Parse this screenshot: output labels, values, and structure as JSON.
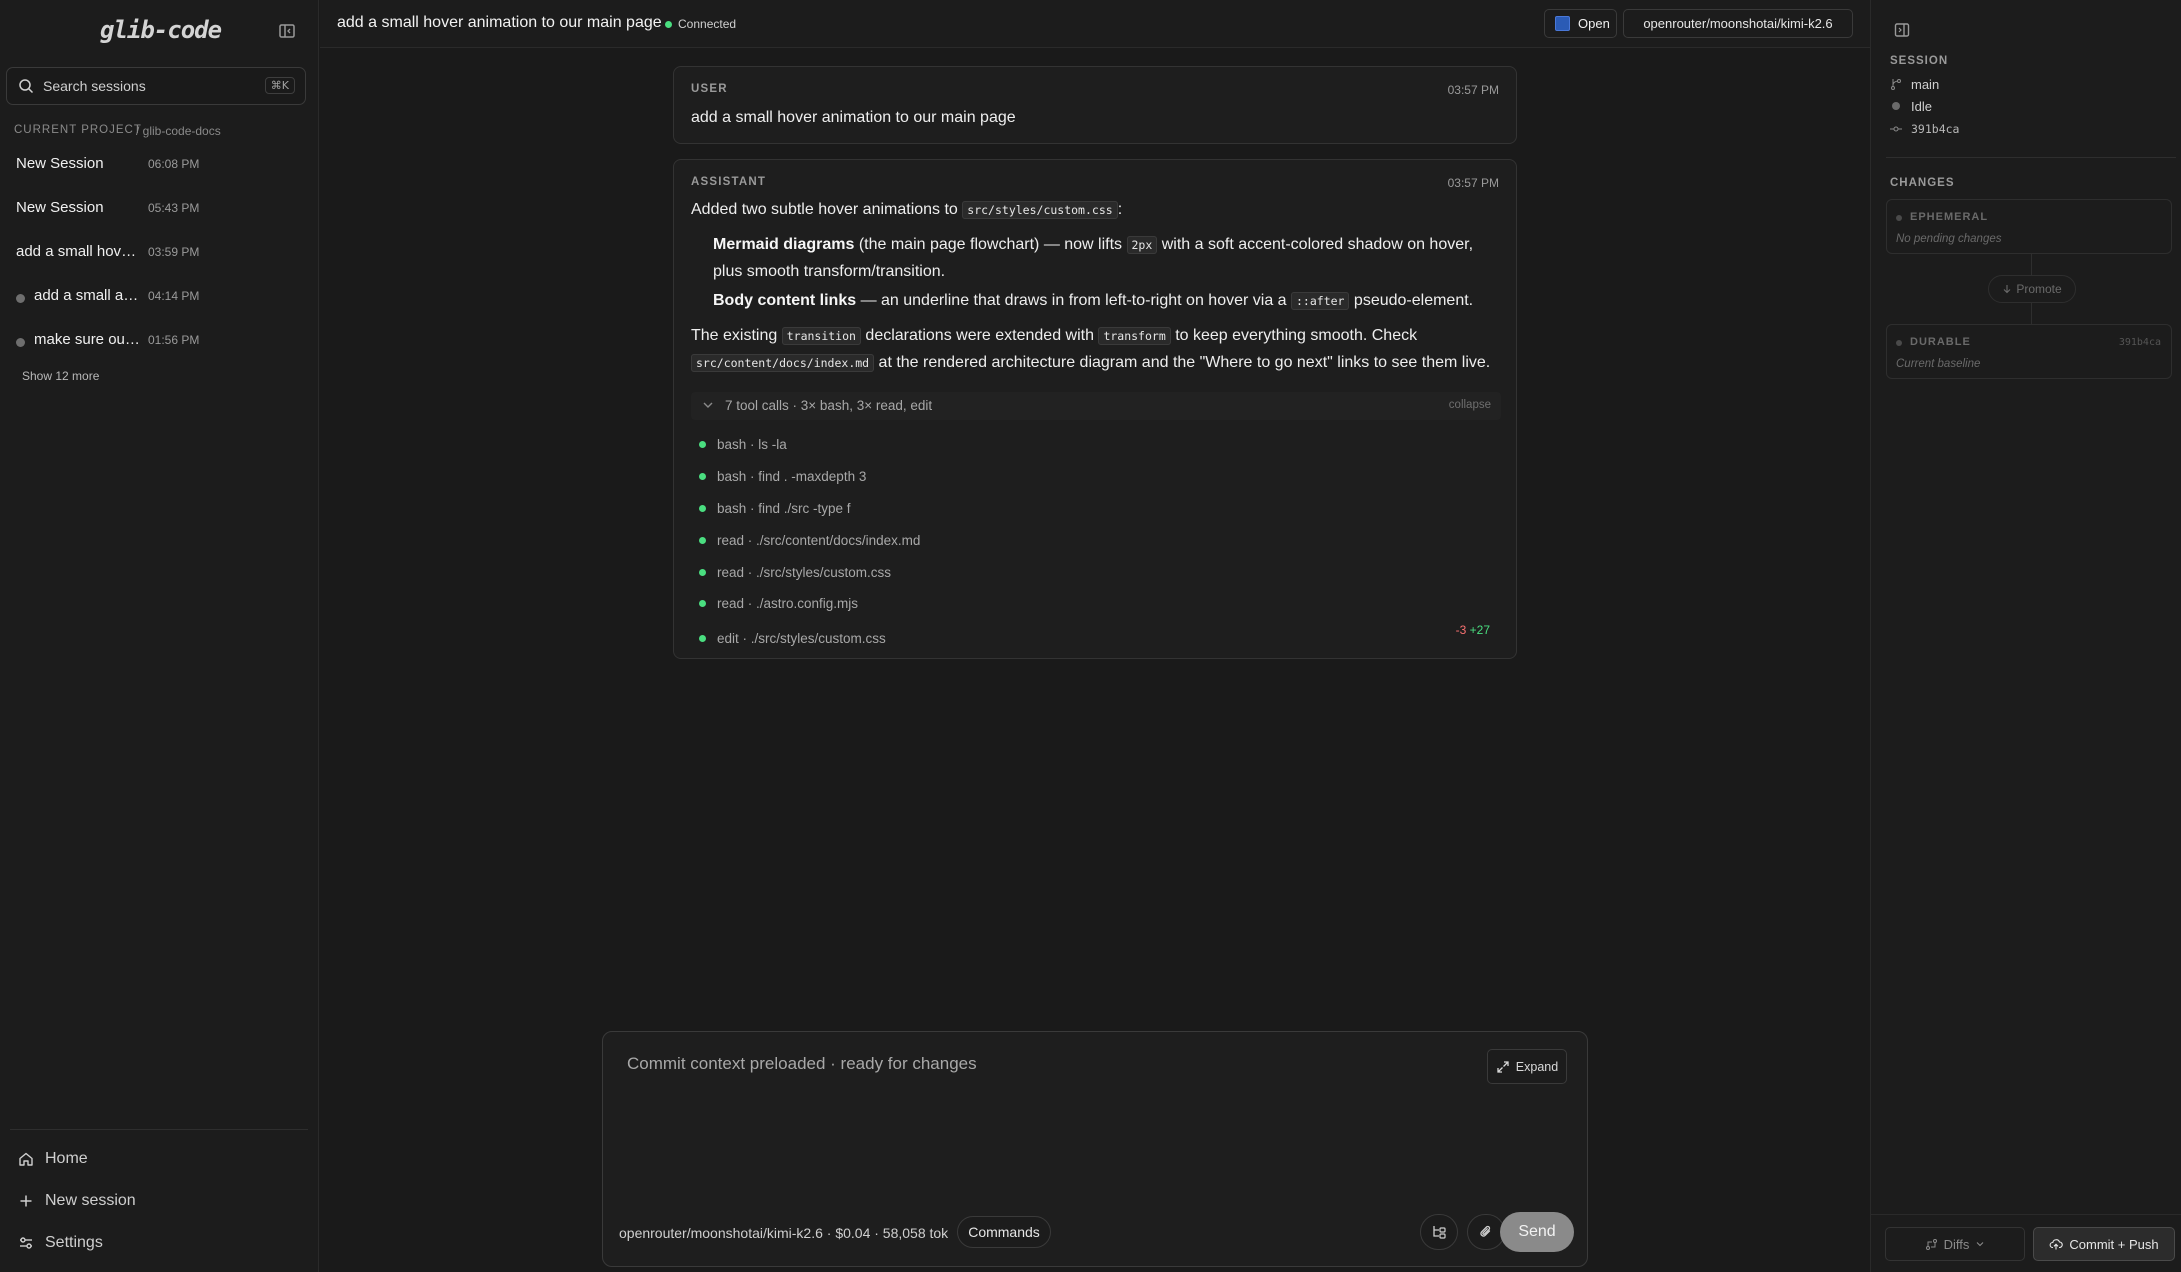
{
  "app": {
    "logo": "glib-code"
  },
  "sidebar": {
    "search_placeholder": "Search sessions",
    "search_shortcut": "⌘K",
    "project_label": "CURRENT PROJECT",
    "project_name": "/ glib-code-docs",
    "sessions": [
      {
        "name": "New Session",
        "time": "06:08 PM",
        "dot": false
      },
      {
        "name": "New Session",
        "time": "05:43 PM",
        "dot": false
      },
      {
        "name": "add a small hover animation to our main page",
        "time": "03:59 PM",
        "dot": false
      },
      {
        "name": "add a small animation",
        "time": "04:14 PM",
        "dot": true
      },
      {
        "name": "make sure our docs",
        "time": "01:56 PM",
        "dot": true
      }
    ],
    "show_more": "Show 12 more",
    "nav": {
      "home": "Home",
      "new_session": "New session",
      "settings": "Settings"
    }
  },
  "topbar": {
    "title": "add a small hover animation to our main page",
    "status": "Connected",
    "open_label": "Open",
    "model": "openrouter/moonshotai/kimi-k2.6"
  },
  "chat": {
    "user": {
      "role": "USER",
      "time": "03:57 PM",
      "text": "add a small hover animation to our main page"
    },
    "assistant": {
      "role": "ASSISTANT",
      "time": "03:57 PM",
      "intro_pre": "Added two subtle hover animations to ",
      "intro_code": "src/styles/custom.css",
      "intro_post": ":",
      "bullet1_bold": "Mermaid diagrams",
      "bullet1_a": " (the main page flowchart) — now lifts ",
      "bullet1_code": "2px",
      "bullet1_b": " with a soft accent-colored shadow on hover,",
      "bullet1_c": "plus smooth transform/transition.",
      "bullet2_bold": "Body content links",
      "bullet2_a": " — an underline that draws in from left-to-right on hover via a ",
      "bullet2_code": "::after",
      "bullet2_b": " pseudo-element.",
      "para_a": "The existing ",
      "para_code1": "transition",
      "para_b": " declarations were extended with ",
      "para_code2": "transform",
      "para_c": " to keep everything smooth. Check",
      "para_code3": "src/content/docs/index.md",
      "para_d": " at the rendered architecture diagram and the \"Where to go next\" links to see them live.",
      "tools_summary": "7 tool calls · 3× bash, 3× read, edit",
      "tools_collapse": "collapse",
      "tools": [
        "bash · ls -la",
        "bash · find . -maxdepth 3",
        "bash · find ./src -type f",
        "read · ./src/content/docs/index.md",
        "read · ./src/styles/custom.css",
        "read · ./astro.config.mjs",
        "edit · ./src/styles/custom.css"
      ],
      "diff_del": "-3",
      "diff_add": "+27"
    }
  },
  "composer": {
    "placeholder": "Commit context preloaded · ready for changes",
    "expand_label": "Expand",
    "meta": "openrouter/moonshotai/kimi-k2.6 · $0.04 · 58,058 tok",
    "commands_label": "Commands",
    "send_label": "Send"
  },
  "rpanel": {
    "session_header": "SESSION",
    "branch": "main",
    "state": "Idle",
    "commit": "391b4ca",
    "changes_header": "CHANGES",
    "ephemeral_label": "EPHEMERAL",
    "ephemeral_sub": "No pending changes",
    "promote_label": "Promote",
    "durable_label": "DURABLE",
    "durable_ref": "391b4ca",
    "durable_sub": "Current baseline",
    "diffs_label": "Diffs",
    "commit_push_label": "Commit + Push"
  },
  "colors": {
    "accent_green": "#4ade80",
    "delete_red": "#f87171",
    "background": "#1a1a1a"
  }
}
